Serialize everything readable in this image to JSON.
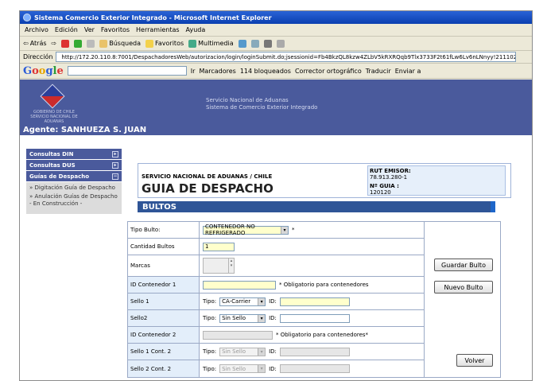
{
  "window": {
    "title": "Sistema Comercio Exterior Integrado - Microsoft Internet Explorer"
  },
  "menu": [
    "Archivo",
    "Edición",
    "Ver",
    "Favoritos",
    "Herramientas",
    "Ayuda"
  ],
  "toolbar": {
    "back": "Atrás",
    "search": "Búsqueda",
    "favorites": "Favoritos",
    "multimedia": "Multimedia"
  },
  "address": {
    "label": "Dirección",
    "url": "http://172.20.110.8:7001/DespachadoresWeb/autorizacion/login/loginSubmit.do;jsessionid=Fb4BkzQL8kzw4ZLbV5kRXRQqb9Tlx3733F2t61fLw6Lv6nLNnyy!2111026951"
  },
  "googlebar": {
    "logo": "Google",
    "go": "Ir",
    "bookmarks": "Marcadores",
    "blocked": "114 bloqueados",
    "spell": "Corrector ortográfico",
    "translate": "Traducir",
    "send": "Enviar a"
  },
  "banner": {
    "line1": "Servicio Nacional de Aduanas",
    "line2": "Sistema de Comercio Exterior Integrado",
    "logo_text": "GOBIERNO DE CHILE",
    "logo_sub": "SERVICIO NACIONAL DE ADUANAS",
    "agent": "Agente: SANHUEZA S. JUAN"
  },
  "sidebar": {
    "items": [
      {
        "label": "Consultas DIN"
      },
      {
        "label": "Consultas DUS"
      },
      {
        "label": "Guías de Despacho"
      }
    ],
    "sub": [
      "» Digitación Guía de Despacho",
      "» Anulación Guías de Despacho - En Construcción -"
    ]
  },
  "header": {
    "org": "SERVICIO NACIONAL DE ADUANAS / CHILE",
    "title": "GUIA DE DESPACHO",
    "rut_label": "RUT EMISOR:",
    "rut": "78.913.280-1",
    "guia_label": "Nº GUIA  :",
    "guia": "120120",
    "section": "BULTOS"
  },
  "form": {
    "tipo_bulto": {
      "label": "Tipo Bulto:",
      "value": "CONTENEDOR NO REFRIGERADO",
      "req": "*"
    },
    "cantidad": {
      "label": "Cantidad Bultos",
      "value": "1"
    },
    "marcas": {
      "label": "Marcas"
    },
    "id_cont1": {
      "label": "ID Contenedor 1",
      "note": "* Obligatorio para contenedores"
    },
    "sello1": {
      "label": "Sello 1",
      "tipo_label": "Tipo:",
      "tipo": "CA-Carrier",
      "id_label": "ID:"
    },
    "sello2": {
      "label": "Sello2",
      "tipo_label": "Tipo:",
      "tipo": "Sin Sello",
      "id_label": "ID:"
    },
    "id_cont2": {
      "label": "ID Contenedor 2",
      "note": "* Obligatorio para contenedores*"
    },
    "sello1c2": {
      "label": "Sello 1 Cont. 2",
      "tipo_label": "Tipo:",
      "tipo": "Sin Sello",
      "id_label": "ID:"
    },
    "sello2c2": {
      "label": "Sello 2 Cont. 2",
      "tipo_label": "Tipo:",
      "tipo": "Sin Sello",
      "id_label": "ID:"
    }
  },
  "buttons": {
    "guardar": "Guardar Bulto",
    "nuevo": "Nuevo Bulto",
    "volver": "Volver"
  }
}
